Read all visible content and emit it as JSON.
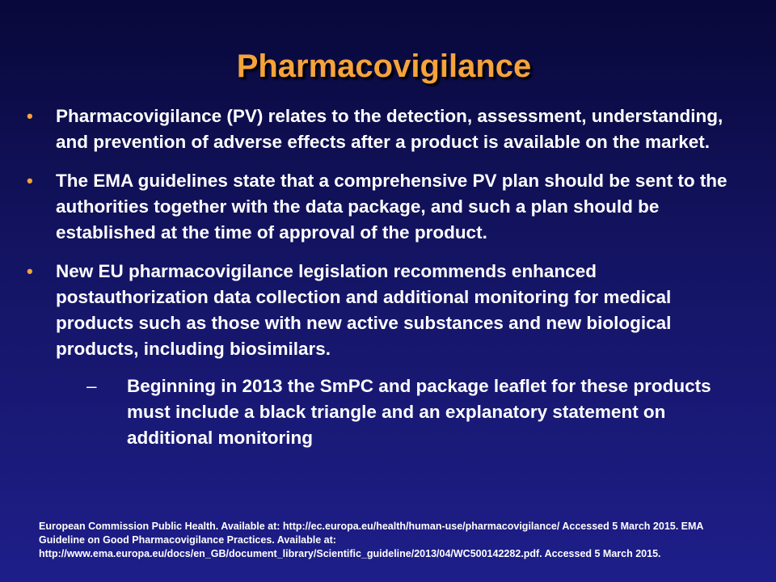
{
  "slide": {
    "title": "Pharmacovigilance",
    "accent_color": "#f5a33a",
    "bullet_symbol": "•",
    "sub_bullet_symbol": "–",
    "bullets": [
      "Pharmacovigilance (PV) relates to the detection, assessment, understanding, and prevention of adverse effects after a product is available on the market.",
      "The EMA guidelines state that a comprehensive PV plan should be sent to the authorities together with the data package, and such a plan should be established at the time of approval of the product.",
      "New EU pharmacovigilance legislation recommends enhanced postauthorization data collection and additional monitoring for medical products such as those with new active substances and new biological products, including biosimilars."
    ],
    "sub_bullets": [
      "Beginning in 2013 the SmPC and package leaflet for these products must include a black triangle and an explanatory statement on additional monitoring"
    ],
    "footnote": "European Commission Public Health. Available at: http://ec.europa.eu/health/human-use/pharmacovigilance/ Accessed 5 March 2015. EMA Guideline on Good Pharmacovigilance Practices. Available at: http://www.ema.europa.eu/docs/en_GB/document_library/Scientific_guideline/2013/04/WC500142282.pdf. Accessed 5 March 2015."
  }
}
